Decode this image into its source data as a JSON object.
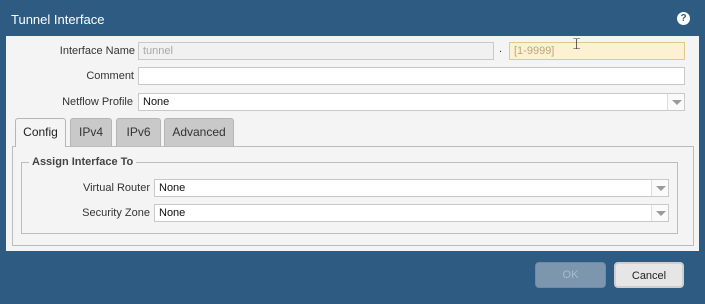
{
  "window": {
    "title": "Tunnel Interface",
    "help_icon": "?"
  },
  "form": {
    "interface_name": {
      "label": "Interface Name",
      "value": "tunnel",
      "separator": ".",
      "suffix_placeholder": "[1-9999]"
    },
    "comment": {
      "label": "Comment",
      "value": ""
    },
    "netflow_profile": {
      "label": "Netflow Profile",
      "value": "None"
    }
  },
  "tabs": [
    {
      "label": "Config",
      "active": true
    },
    {
      "label": "IPv4",
      "active": false
    },
    {
      "label": "IPv6",
      "active": false
    },
    {
      "label": "Advanced",
      "active": false
    }
  ],
  "assign": {
    "legend": "Assign Interface To",
    "virtual_router": {
      "label": "Virtual Router",
      "value": "None"
    },
    "security_zone": {
      "label": "Security Zone",
      "value": "None"
    }
  },
  "buttons": {
    "ok": "OK",
    "cancel": "Cancel"
  },
  "colors": {
    "header": "#2e5b81",
    "panel": "#f4f4f4",
    "warning_field": "#fdf1d3"
  }
}
